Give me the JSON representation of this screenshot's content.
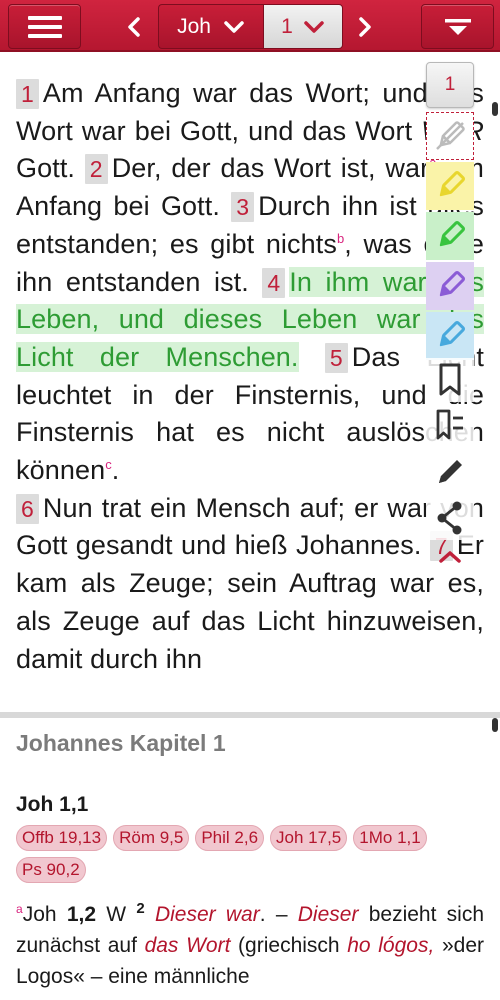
{
  "toolbar": {
    "book": "Joh",
    "chapter": "1",
    "icons": [
      "menu-icon",
      "chevron-left-icon",
      "chevron-down-icon",
      "chevron-right-icon",
      "filter-icon"
    ]
  },
  "colors": {
    "brand_red": "#c0203a",
    "highlight_green": "#d6f2d6",
    "highlight_green_text": "#2e9c34",
    "marker_yellow": "#f0e040",
    "marker_green": "#39c43f",
    "marker_purple": "#8b5cd6",
    "marker_blue": "#48a9dd",
    "chip_bg": "#f1c7cf"
  },
  "verses": [
    {
      "num": "1",
      "segments": [
        "Am Anfang war das Wort; und das Wort war bei Gott, und das Wort ",
        "WAR",
        " Gott."
      ]
    },
    {
      "num": "2",
      "text": "Der, der das Wort ist, war",
      "fn": "a",
      "text2": " am Anfang bei Gott."
    },
    {
      "num": "3",
      "text": "Durch ihn ist alles entstanden; es gibt nichts",
      "fn": "b",
      "text2": ", was ohne ihn entstanden ist."
    },
    {
      "num": "4",
      "text": "In ihm war das Leben, und dieses Leben war das Licht der Menschen."
    },
    {
      "num": "5",
      "text": "Das Licht leuchtet in der Finsternis, und die Finsternis hat es nicht auslöschen können",
      "fn": "c",
      "text2": "."
    },
    {
      "num": "6",
      "text": "Nun trat ein Mensch auf; er war von Gott gesandt und hieß Johannes."
    },
    {
      "num": "7",
      "text": "Er kam als Zeuge; sein Auftrag war es, als Zeuge auf das Licht hinzuweisen, damit durch ihn"
    }
  ],
  "side_toolbar": {
    "chapter": "1",
    "icons": [
      "eraser-marker-icon",
      "yellow-marker-icon",
      "green-marker-icon",
      "purple-marker-icon",
      "blue-marker-icon",
      "bookmark-icon",
      "bookmark-list-icon",
      "pencil-icon",
      "share-icon",
      "chevron-up-icon"
    ]
  },
  "commentary": {
    "title": "Johannes Kapitel 1",
    "reference": "Joh 1,1",
    "chips": [
      "Offb 19,13",
      "Röm 9,5",
      "Phil 2,6",
      "Joh 17,5",
      "1Mo 1,1",
      "Ps 90,2"
    ],
    "note": {
      "fn_mark": "a",
      "ref_a": "Joh ",
      "ref_b": "1,2",
      "ref_c": " W ",
      "sup": "2",
      "em1": "Dieser war",
      "t1": ". – ",
      "em2": "Dieser",
      "t2": " bezieht sich zunächst auf ",
      "em3": "das Wort",
      "t3": " (griechisch ",
      "em4": "ho lógos,",
      "t4": " »der Logos« – eine männliche"
    }
  }
}
